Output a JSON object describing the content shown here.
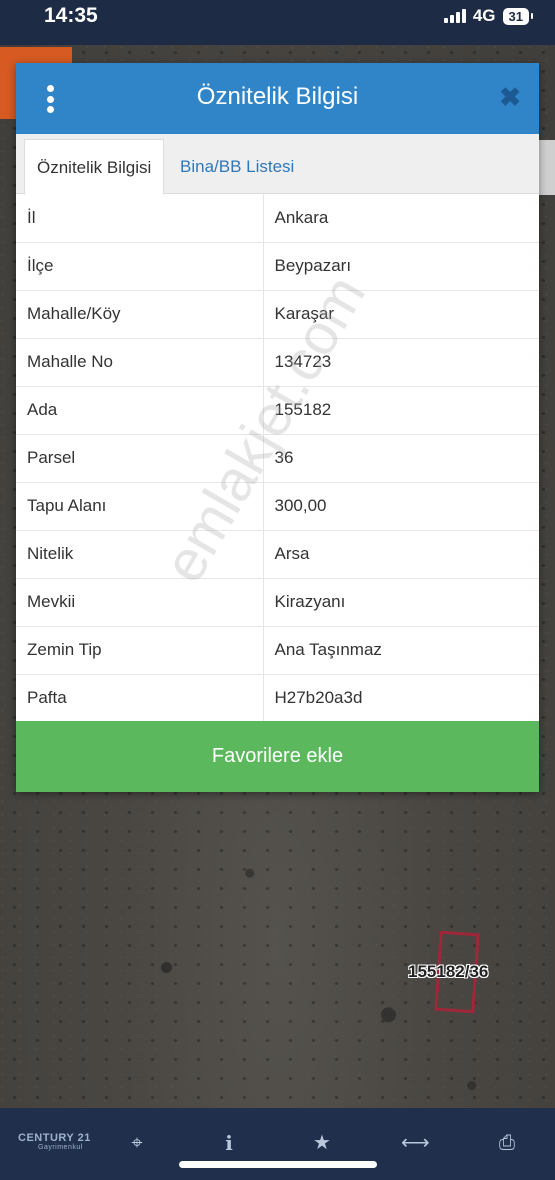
{
  "status_bar": {
    "time": "14:35",
    "network": "4G",
    "battery": "31"
  },
  "dialog": {
    "title": "Öznitelik Bilgisi",
    "tabs": [
      {
        "label": "Öznitelik Bilgisi",
        "active": true
      },
      {
        "label": "Bina/BB Listesi",
        "active": false
      }
    ],
    "rows": [
      {
        "key": "İl",
        "value": "Ankara"
      },
      {
        "key": "İlçe",
        "value": "Beypazarı"
      },
      {
        "key": "Mahalle/Köy",
        "value": "Karaşar"
      },
      {
        "key": "Mahalle No",
        "value": "134723"
      },
      {
        "key": "Ada",
        "value": "155182"
      },
      {
        "key": "Parsel",
        "value": "36"
      },
      {
        "key": "Tapu Alanı",
        "value": "300,00"
      },
      {
        "key": "Nitelik",
        "value": "Arsa"
      },
      {
        "key": "Mevkii",
        "value": "Kirazyanı"
      },
      {
        "key": "Zemin Tip",
        "value": "Ana Taşınmaz"
      },
      {
        "key": "Pafta",
        "value": "H27b20a3d"
      }
    ],
    "favorite_button": "Favorilere ekle"
  },
  "watermark": "emlakjet.com",
  "map": {
    "parcel_label": "155182/36"
  },
  "toolbar": {
    "brand": "CENTURY 21",
    "brand_sub": "Gayrimenkul",
    "icons": [
      "crosshair-icon",
      "info-icon",
      "star-icon",
      "measure-icon",
      "print-icon"
    ]
  },
  "colors": {
    "header": "#2f85c8",
    "button": "#5cb85c",
    "toolbar": "#1f2f4c",
    "parcel": "#a0263a"
  }
}
